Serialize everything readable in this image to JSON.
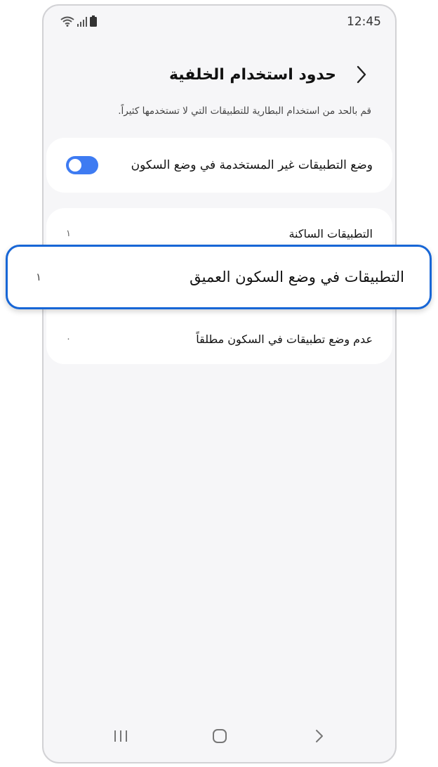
{
  "status_bar": {
    "time": "12:45",
    "icons": [
      "wifi-icon",
      "signal-icon",
      "battery-icon"
    ]
  },
  "header": {
    "title": "حدود استخدام الخلفية",
    "back_icon": "chevron-right-icon"
  },
  "description": "قم بالحد من استخدام البطارية للتطبيقات التي لا تستخدمها كثيراً.",
  "toggle": {
    "label": "وضع التطبيقات غير المستخدمة في وضع السكون",
    "state": "on",
    "color": "#3e7bf2"
  },
  "list": [
    {
      "label": "التطبيقات الساكنة",
      "count": "١"
    },
    {
      "label": "التطبيقات في وضع السكون العميق",
      "count": "١"
    },
    {
      "label": "عدم وضع تطبيقات في السكون مطلقاً",
      "count": "٠"
    }
  ],
  "highlight_color": "#1766d6",
  "nav_bar": [
    "recent-apps-icon",
    "home-icon",
    "back-icon"
  ]
}
